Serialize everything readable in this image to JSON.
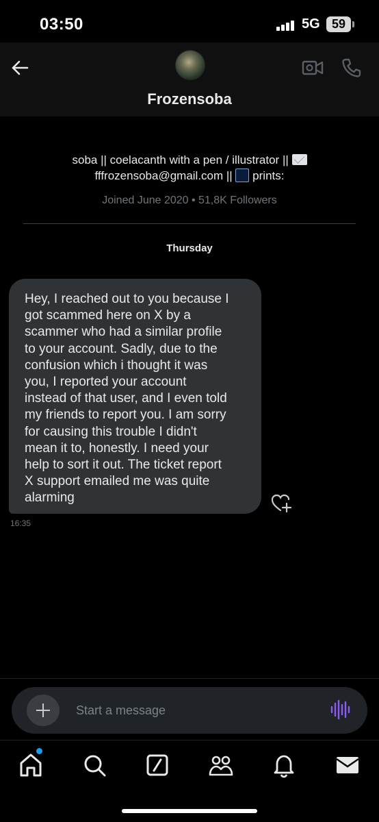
{
  "status_bar": {
    "time": "03:50",
    "network": "5G",
    "battery": "59"
  },
  "header": {
    "contact_name": "Frozensoba",
    "icons": [
      "back-arrow-icon",
      "video-call-icon",
      "phone-icon"
    ]
  },
  "profile": {
    "bio_line1": "soba || coelacanth with a pen / illustrator || ",
    "bio_line2_email": "fffrozensoba@gmail.com",
    "bio_line2_sep": " || ",
    "bio_line2_tail": " prints:",
    "joined": "Joined June 2020 • 51,8K Followers"
  },
  "conversation": {
    "day_label": "Thursday",
    "messages": [
      {
        "lines": [
          "Hey, I reached out to you because I",
          "got scammed here on X by a",
          "scammer who had a similar profile",
          "to your account. Sadly, due to the",
          "confusion which i thought it was",
          "you, I reported your account",
          "instead of that user, and I even told",
          "my friends to report you. I am sorry",
          "for causing this trouble I didn't",
          "mean it to, honestly. I need your",
          "help to sort it out. The ticket report",
          "X support emailed me was quite",
          "alarming"
        ],
        "time": "16:35"
      }
    ]
  },
  "composer": {
    "placeholder": "Start a message",
    "value": ""
  },
  "tabs": [
    "home",
    "search",
    "grok",
    "communities",
    "notifications",
    "messages"
  ],
  "colors": {
    "background": "#000000",
    "bubble": "#2f3336",
    "accent_blue": "#1d9bf0",
    "voice_purple": "#8b5cf6",
    "muted_text": "#71767b"
  }
}
